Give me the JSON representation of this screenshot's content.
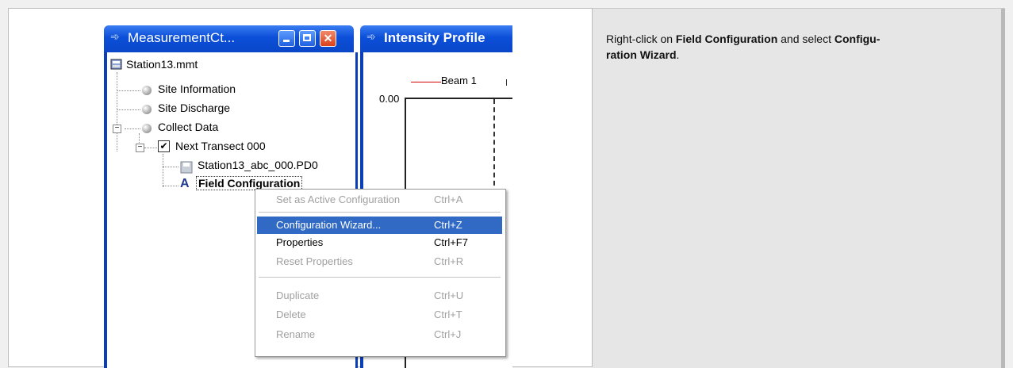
{
  "instruction": {
    "prefix": "Right-click on ",
    "bold1": "Field Configuration",
    "middle": " and select ",
    "bold2a": "Configu-",
    "bold2b": "ration Wizard",
    "suffix": "."
  },
  "window": {
    "title": "MeasurementCt...",
    "logo": "⸎"
  },
  "second_window": {
    "title": "Intensity Profile",
    "legend_label": "Beam 1",
    "axis_value": "0.00"
  },
  "tree": {
    "root": "Station13.mmt",
    "items": [
      "Site Information",
      "Site Discharge",
      "Collect Data",
      "Next Transect 000",
      "Station13_abc_000.PD0",
      "Field Configuration"
    ]
  },
  "context_menu": {
    "items": [
      {
        "label": "Set as Active Configuration",
        "shortcut": "Ctrl+A"
      },
      {
        "label": "Configuration Wizard...",
        "shortcut": "Ctrl+Z"
      },
      {
        "label": "Properties",
        "shortcut": "Ctrl+F7"
      },
      {
        "label": "Reset Properties",
        "shortcut": "Ctrl+R"
      },
      {
        "label": "Duplicate",
        "shortcut": "Ctrl+U"
      },
      {
        "label": "Delete",
        "shortcut": "Ctrl+T"
      },
      {
        "label": "Rename",
        "shortcut": "Ctrl+J"
      }
    ]
  },
  "colors": {
    "titlebar": "#0b4fd8",
    "menu_highlight": "#316ac5",
    "close_button": "#d9411c",
    "beam_line": "#d40000"
  }
}
